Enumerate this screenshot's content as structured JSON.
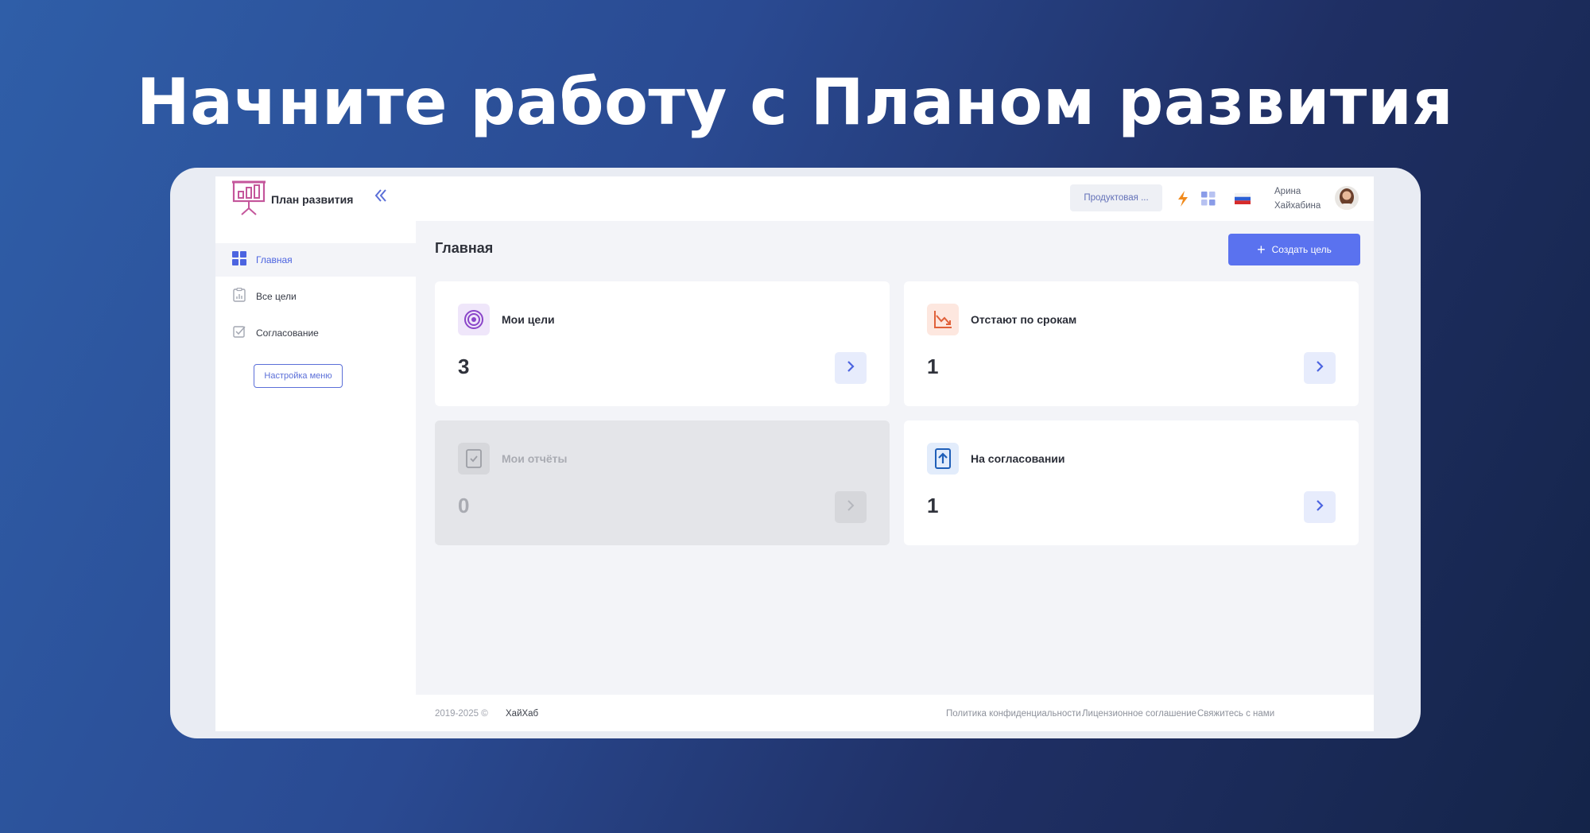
{
  "hero": {
    "title": "Начните работу с Планом развития"
  },
  "sidebar": {
    "brand": "План развития",
    "items": [
      {
        "label": "Главная",
        "icon": "grid-icon",
        "active": true
      },
      {
        "label": "Все цели",
        "icon": "clipboard-icon",
        "active": false
      },
      {
        "label": "Согласование",
        "icon": "checkbox-icon",
        "active": false
      }
    ],
    "menu_settings_label": "Настройка меню"
  },
  "header": {
    "org_label": "Продуктовая ...",
    "user_first": "Арина",
    "user_last": "Хайхабина"
  },
  "main": {
    "page_title": "Главная",
    "create_button": "Создать цель",
    "cards": [
      {
        "title": "Мои цели",
        "count": "3",
        "icon": "target-icon",
        "disabled": false
      },
      {
        "title": "Отстают по срокам",
        "count": "1",
        "icon": "trend-down-icon",
        "disabled": false
      },
      {
        "title": "Мои отчёты",
        "count": "0",
        "icon": "report-icon",
        "disabled": true
      },
      {
        "title": "На согласовании",
        "count": "1",
        "icon": "upload-doc-icon",
        "disabled": false
      }
    ]
  },
  "footer": {
    "copyright": "2019-2025 ©",
    "company": "ХайХаб",
    "links": [
      "Политика конфиденциальности",
      "Лицензионное соглашение",
      "Свяжитесь с нами"
    ]
  },
  "colors": {
    "accent": "#5a72ef",
    "sidebar_active": "#4c64e0",
    "bolt": "#f08a1c"
  }
}
